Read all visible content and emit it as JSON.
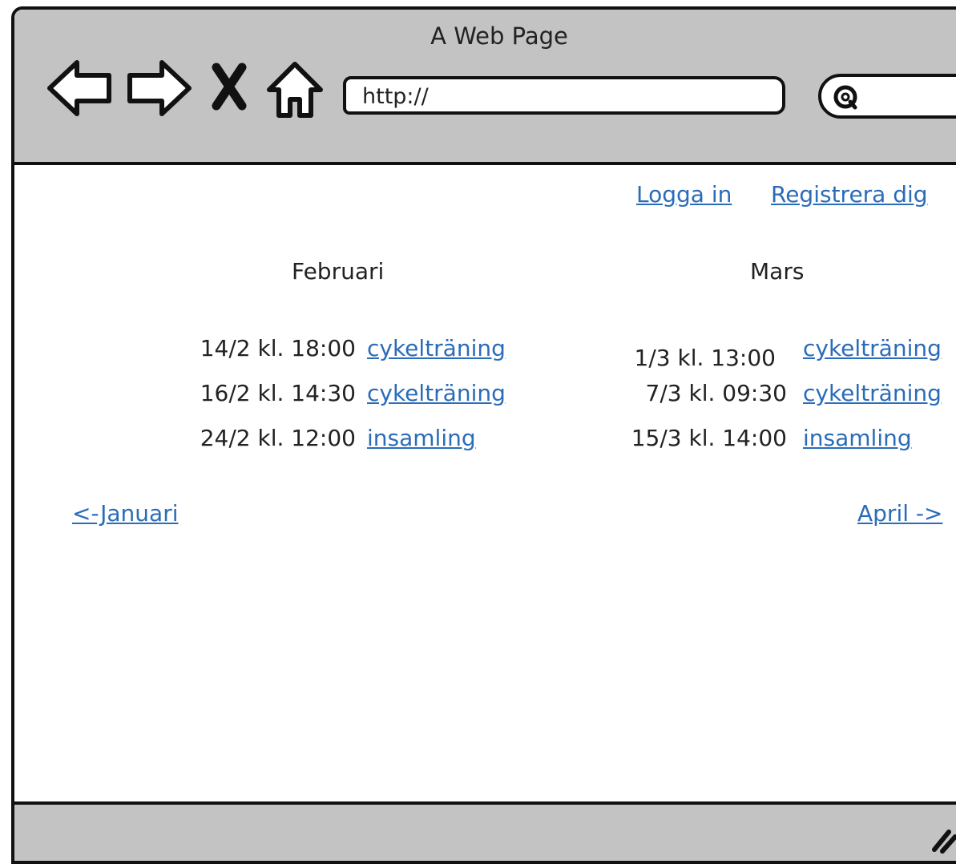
{
  "window": {
    "title": "A Web Page"
  },
  "toolbar": {
    "url": "http://",
    "icons": [
      "back-arrow-icon",
      "forward-arrow-icon",
      "close-icon",
      "home-icon",
      "search-icon"
    ]
  },
  "auth": {
    "login": "Logga in",
    "register": "Registrera dig"
  },
  "months": [
    {
      "name": "Februari",
      "events": [
        {
          "date": "14/2 kl. 18:00",
          "activity": "cykelträning"
        },
        {
          "date": "16/2 kl. 14:30",
          "activity": "cykelträning"
        },
        {
          "date": "24/2 kl. 12:00",
          "activity": "insamling"
        }
      ]
    },
    {
      "name": "Mars",
      "events": [
        {
          "date": "1/3 kl. 13:00",
          "activity": "cykelträning"
        },
        {
          "date": "7/3 kl. 09:30",
          "activity": "cykelträning"
        },
        {
          "date": "15/3 kl. 14:00",
          "activity": "insamling"
        }
      ]
    }
  ],
  "pagination": {
    "prev": "<-Januari",
    "next": "April ->"
  }
}
